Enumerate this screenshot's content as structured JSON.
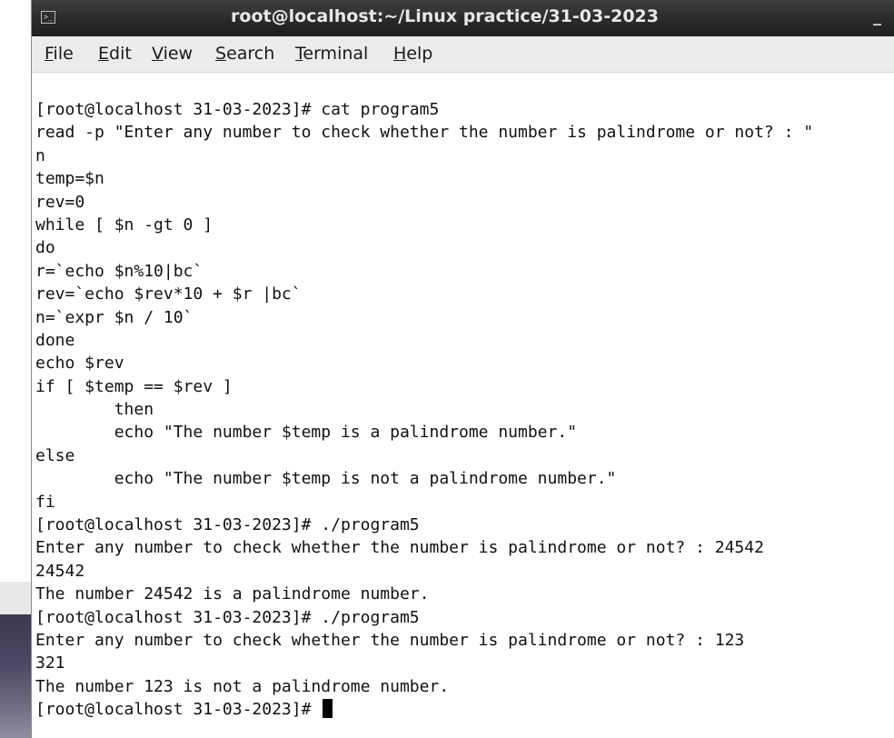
{
  "window": {
    "title": "root@localhost:~/Linux practice/31-03-2023",
    "minimize_glyph": "_"
  },
  "menu": [
    {
      "pre": "",
      "u": "F",
      "post": "ile"
    },
    {
      "pre": "",
      "u": "E",
      "post": "dit"
    },
    {
      "pre": "",
      "u": "V",
      "post": "iew"
    },
    {
      "pre": "",
      "u": "S",
      "post": "earch"
    },
    {
      "pre": "",
      "u": "T",
      "post": "erminal"
    },
    {
      "pre": "",
      "u": "H",
      "post": "elp"
    }
  ],
  "terminal": {
    "lines": [
      "[root@localhost 31-03-2023]# cat program5",
      "read -p \"Enter any number to check whether the number is palindrome or not? : \"",
      "n",
      "temp=$n",
      "rev=0",
      "while [ $n -gt 0 ]",
      "do",
      "r=`echo $n%10|bc`",
      "rev=`echo $rev*10 + $r |bc`",
      "n=`expr $n / 10`",
      "done",
      "echo $rev",
      "if [ $temp == $rev ]",
      "        then",
      "        echo \"The number $temp is a palindrome number.\"",
      "else",
      "        echo \"The number $temp is not a palindrome number.\"",
      "fi",
      "[root@localhost 31-03-2023]# ./program5",
      "Enter any number to check whether the number is palindrome or not? : 24542",
      "24542",
      "The number 24542 is a palindrome number.",
      "[root@localhost 31-03-2023]# ./program5",
      "Enter any number to check whether the number is palindrome or not? : 123",
      "321",
      "The number 123 is not a palindrome number."
    ],
    "prompt": "[root@localhost 31-03-2023]# "
  }
}
